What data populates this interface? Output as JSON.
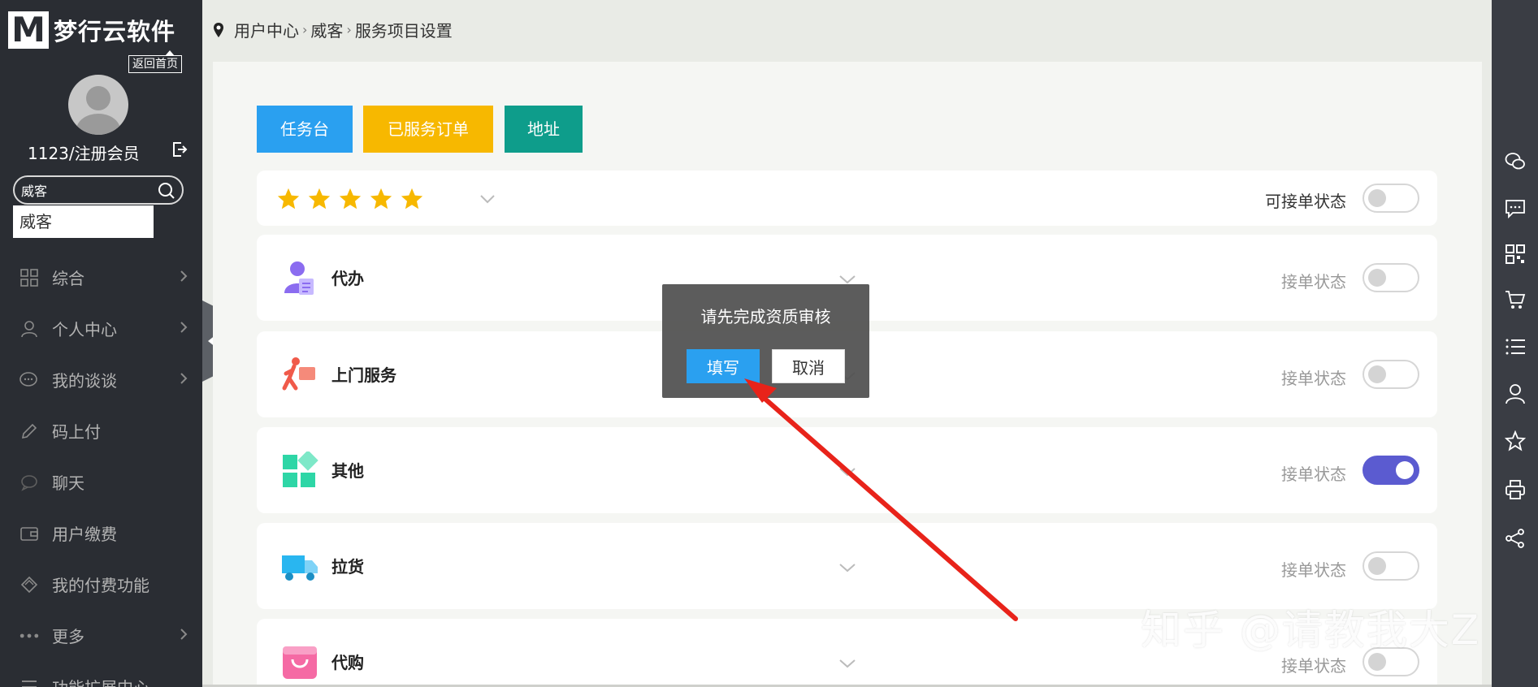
{
  "brand": {
    "name": "梦行云软件",
    "logo_letter": "M",
    "back_home": "返回首页"
  },
  "user": {
    "name": "1123/注册会员"
  },
  "search": {
    "value": "威客",
    "suggestion": "威客"
  },
  "sidebar": {
    "items": [
      {
        "label": "综合",
        "icon": "grid-icon",
        "has_submenu": true
      },
      {
        "label": "个人中心",
        "icon": "person-icon",
        "has_submenu": true
      },
      {
        "label": "我的谈谈",
        "icon": "chat-bubble-icon",
        "has_submenu": true
      },
      {
        "label": "码上付",
        "icon": "pencil-icon",
        "has_submenu": false
      },
      {
        "label": "聊天",
        "icon": "speech-icon",
        "has_submenu": false
      },
      {
        "label": "用户缴费",
        "icon": "wallet-icon",
        "has_submenu": false
      },
      {
        "label": "我的付费功能",
        "icon": "diamond-icon",
        "has_submenu": false
      },
      {
        "label": "更多",
        "icon": "dots-icon",
        "has_submenu": true
      },
      {
        "label": "功能扩展中心",
        "icon": "menu-icon",
        "has_submenu": false
      }
    ]
  },
  "breadcrumb": [
    "用户中心",
    "威客",
    "服务项目设置"
  ],
  "buttons": {
    "task": "任务台",
    "served_orders": "已服务订单",
    "address": "地址"
  },
  "rating": {
    "stars": 5,
    "label": "可接单状态",
    "toggle_on": false
  },
  "services": [
    {
      "name": "代办",
      "label": "接单状态",
      "toggle_on": false,
      "icon": "agent-person-icon"
    },
    {
      "name": "上门服务",
      "label": "接单状态",
      "toggle_on": false,
      "icon": "delivery-runner-icon"
    },
    {
      "name": "其他",
      "label": "接单状态",
      "toggle_on": true,
      "icon": "blocks-icon"
    },
    {
      "name": "拉货",
      "label": "接单状态",
      "toggle_on": false,
      "icon": "truck-icon"
    },
    {
      "name": "代购",
      "label": "接单状态",
      "toggle_on": false,
      "icon": "shopping-bag-icon"
    }
  ],
  "modal": {
    "message": "请先完成资质审核",
    "fill_label": "填写",
    "cancel_label": "取消"
  },
  "toolbar": [
    "wechat-icon",
    "message-icon",
    "qrcode-icon",
    "cart-icon",
    "list-icon",
    "user-icon",
    "star-icon",
    "printer-icon",
    "share-icon"
  ],
  "watermark": "知乎 @请教我大Z",
  "colors": {
    "sidebar_bg": "#2a2d33",
    "task_button": "#2aa0f0",
    "served_button": "#f7b800",
    "address_button": "#0e9d8b",
    "toggle_on": "#5b5bd0",
    "star": "#f7b800",
    "arrow": "#e8231a"
  }
}
